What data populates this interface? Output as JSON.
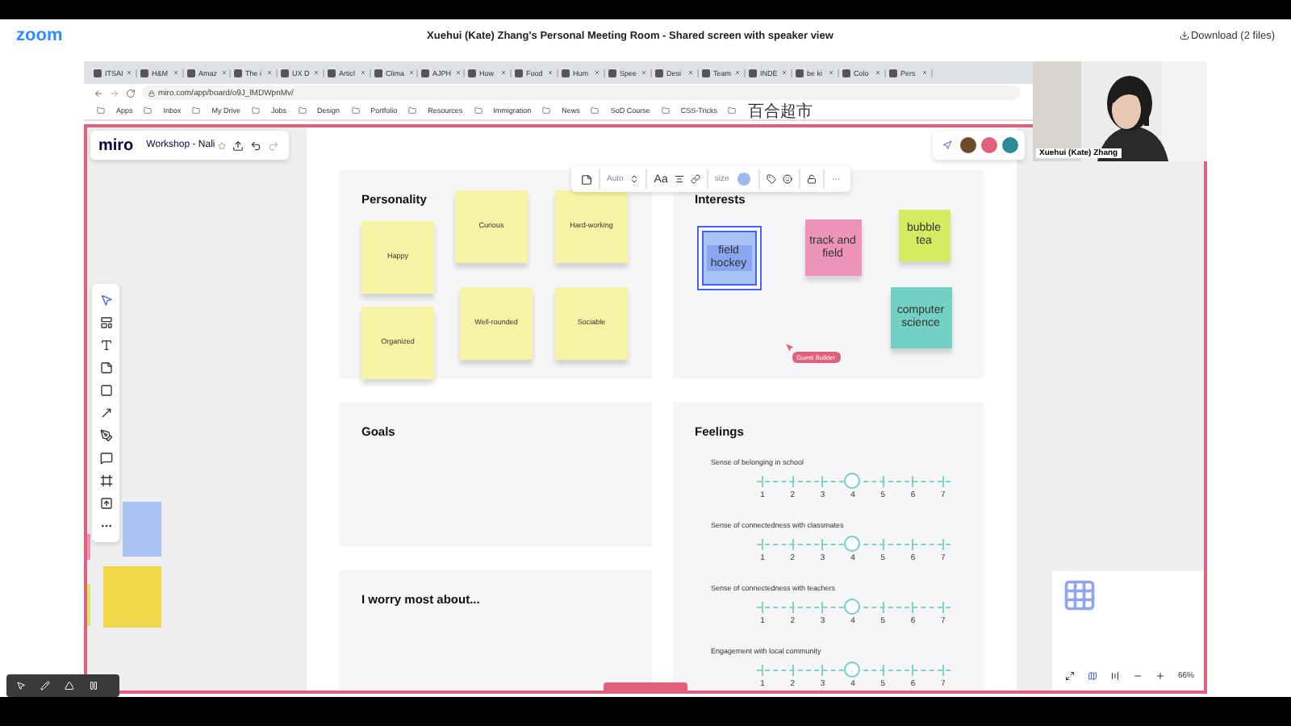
{
  "zoom_bar": {
    "logo": "zoom",
    "title": "Xuehui (Kate) Zhang's Personal Meeting Room - Shared screen with speaker view",
    "download": "Download (2 files)"
  },
  "browser": {
    "tabs": [
      "ITSAI",
      "H&M",
      "Amaz",
      "The i",
      "UX D",
      "Articl",
      "Clima",
      "AJPH",
      "How",
      "Food",
      "Hum",
      "Spee",
      "Desi",
      "Team",
      "INDE",
      "be ki",
      "Colo",
      "Pers"
    ],
    "address": "miro.com/app/board/o9J_lMDWpnMv/",
    "bookmarks": [
      "Apps",
      "Inbox",
      "My Drive",
      "Jobs",
      "Design",
      "Portfolio",
      "Resources",
      "Immigration",
      "News",
      "SoD Course",
      "CSS-Tricks",
      "百合超市"
    ]
  },
  "speaker": {
    "name": "Xuehui (Kate) Zhang",
    "kind": "picture"
  },
  "miro": {
    "logo": "miro",
    "board_name": "Workshop - Nali",
    "context_toolbar": {
      "font_size": "Auto",
      "text_style": "Aa",
      "size_label": "size",
      "color": "#9db8ee"
    },
    "sections": [
      {
        "kind": "stickies",
        "title": "Personality",
        "notes": [
          {
            "text": "Happy",
            "color": "#f8f4a6",
            "selected": false
          },
          {
            "text": "Curious",
            "color": "#f8f4a6",
            "selected": false
          },
          {
            "text": "Hard-working",
            "color": "#f8f4a6",
            "selected": false
          },
          {
            "text": "Organized",
            "color": "#f8f4a6",
            "selected": false
          },
          {
            "text": "Well-rounded",
            "color": "#f8f4a6",
            "selected": false
          },
          {
            "text": "Sociable",
            "color": "#f8f4a6",
            "selected": false
          }
        ]
      },
      {
        "kind": "stickies",
        "title": "Interests",
        "cursor": "Guest Builder",
        "notes": [
          {
            "text": "field hockey",
            "color": "#a9c3f2",
            "selected": true
          },
          {
            "text": "track and field",
            "color": "#ee94bb",
            "selected": false
          },
          {
            "text": "bubble tea",
            "color": "#d6ea62",
            "selected": false
          },
          {
            "text": "computer science",
            "color": "#73d0c4",
            "selected": false
          }
        ]
      },
      {
        "kind": "empty",
        "title": "Goals"
      },
      {
        "kind": "scales",
        "title": "Feelings",
        "scales": [
          {
            "label": "Sense of belonging in school",
            "ticks": [
              {
                "label": "1",
                "selected": false
              },
              {
                "label": "2",
                "selected": false
              },
              {
                "label": "3",
                "selected": false
              },
              {
                "label": "4",
                "selected": true
              },
              {
                "label": "5",
                "selected": false
              },
              {
                "label": "6",
                "selected": false
              },
              {
                "label": "7",
                "selected": false
              }
            ]
          },
          {
            "label": "Sense of connectedness with classmates",
            "ticks": [
              {
                "label": "1",
                "selected": false
              },
              {
                "label": "2",
                "selected": false
              },
              {
                "label": "3",
                "selected": false
              },
              {
                "label": "4",
                "selected": true
              },
              {
                "label": "5",
                "selected": false
              },
              {
                "label": "6",
                "selected": false
              },
              {
                "label": "7",
                "selected": false
              }
            ]
          },
          {
            "label": "Sense of connectedness with teachers",
            "ticks": [
              {
                "label": "1",
                "selected": false
              },
              {
                "label": "2",
                "selected": false
              },
              {
                "label": "3",
                "selected": false
              },
              {
                "label": "4",
                "selected": true
              },
              {
                "label": "5",
                "selected": false
              },
              {
                "label": "6",
                "selected": false
              },
              {
                "label": "7",
                "selected": false
              }
            ]
          },
          {
            "label": "Engagement with local community",
            "ticks": [
              {
                "label": "1",
                "selected": false
              },
              {
                "label": "2",
                "selected": false
              },
              {
                "label": "3",
                "selected": false
              },
              {
                "label": "4",
                "selected": true
              },
              {
                "label": "5",
                "selected": false
              },
              {
                "label": "6",
                "selected": false
              },
              {
                "label": "7",
                "selected": false
              }
            ]
          }
        ]
      },
      {
        "kind": "empty",
        "title": "I worry most about..."
      }
    ],
    "zoom_level": "66%"
  }
}
